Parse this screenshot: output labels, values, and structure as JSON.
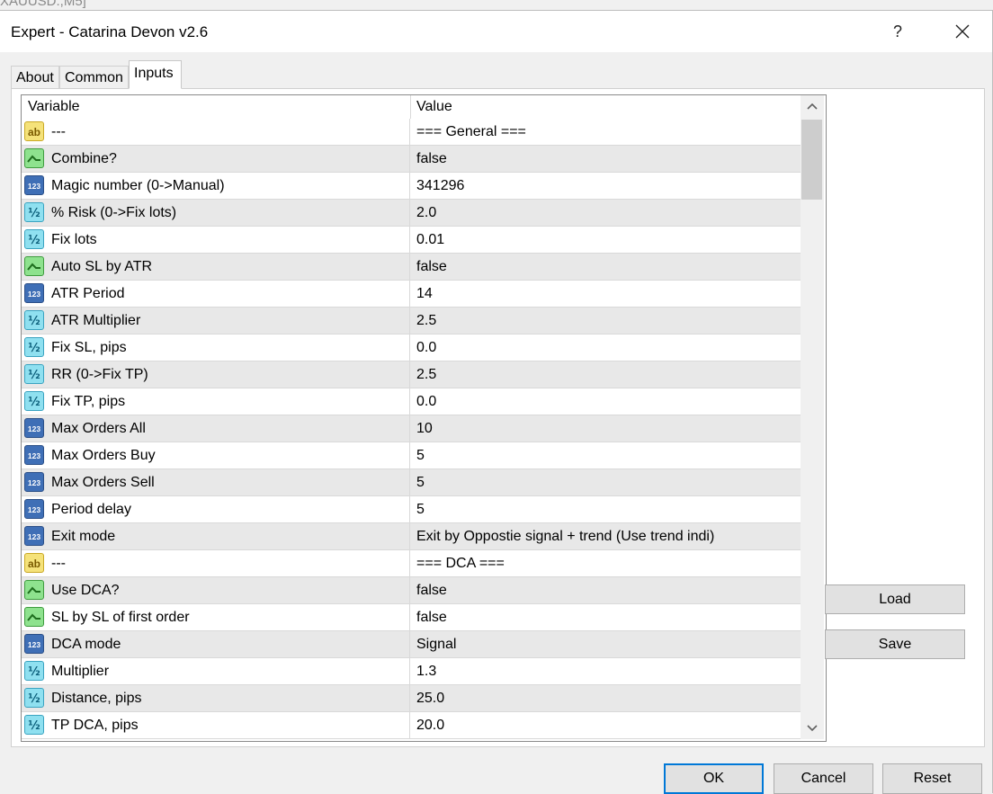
{
  "background": {
    "title_fragment": "XAUUSD.,M5]"
  },
  "window": {
    "title": "Expert - Catarina Devon v2.6",
    "help_label": "?",
    "close_label": "✕"
  },
  "tabs": [
    {
      "label": "About"
    },
    {
      "label": "Common"
    },
    {
      "label": "Inputs",
      "active": true
    }
  ],
  "grid": {
    "columns": {
      "variable": "Variable",
      "value": "Value"
    },
    "rows": [
      {
        "type": "string",
        "variable": "---",
        "value": "=== General ==="
      },
      {
        "type": "bool",
        "variable": "Combine?",
        "value": "false"
      },
      {
        "type": "int",
        "variable": "Magic number (0->Manual)",
        "value": "341296"
      },
      {
        "type": "double",
        "variable": "% Risk (0->Fix lots)",
        "value": "2.0"
      },
      {
        "type": "double",
        "variable": "Fix lots",
        "value": "0.01"
      },
      {
        "type": "bool",
        "variable": "Auto SL by ATR",
        "value": "false"
      },
      {
        "type": "int",
        "variable": "ATR Period",
        "value": "14"
      },
      {
        "type": "double",
        "variable": "ATR Multiplier",
        "value": "2.5"
      },
      {
        "type": "double",
        "variable": "Fix SL, pips",
        "value": "0.0"
      },
      {
        "type": "double",
        "variable": "RR (0->Fix TP)",
        "value": "2.5"
      },
      {
        "type": "double",
        "variable": "Fix TP, pips",
        "value": "0.0"
      },
      {
        "type": "int",
        "variable": "Max Orders All",
        "value": "10"
      },
      {
        "type": "int",
        "variable": "Max Orders Buy",
        "value": "5"
      },
      {
        "type": "int",
        "variable": "Max Orders Sell",
        "value": "5"
      },
      {
        "type": "int",
        "variable": "Period delay",
        "value": "5"
      },
      {
        "type": "int",
        "variable": "Exit mode",
        "value": "Exit by Oppostie signal + trend (Use trend indi)"
      },
      {
        "type": "string",
        "variable": "---",
        "value": "=== DCA ==="
      },
      {
        "type": "bool",
        "variable": "Use DCA?",
        "value": "false"
      },
      {
        "type": "bool",
        "variable": "SL by SL of first order",
        "value": "false"
      },
      {
        "type": "int",
        "variable": "DCA mode",
        "value": "Signal"
      },
      {
        "type": "double",
        "variable": "Multiplier",
        "value": "1.3"
      },
      {
        "type": "double",
        "variable": "Distance, pips",
        "value": "25.0"
      },
      {
        "type": "double",
        "variable": "TP DCA, pips",
        "value": "20.0"
      }
    ]
  },
  "icons": {
    "string": {
      "name": "string-type-icon",
      "text": "ab",
      "bg": "#f5e27a",
      "border": "#c9a825",
      "fg": "#7a5a00"
    },
    "bool": {
      "name": "bool-type-icon",
      "bg": "#8ee28e",
      "border": "#3f9b3f",
      "fg": "#1e6e1e"
    },
    "int": {
      "name": "integer-type-icon",
      "text": "123",
      "bg": "#3f6fb6",
      "border": "#2b4f87",
      "fg": "#ffffff"
    },
    "double": {
      "name": "double-type-icon",
      "text": "½",
      "bg": "#8fe0f0",
      "border": "#3aa3c0",
      "fg": "#0b5e7a"
    }
  },
  "buttons": {
    "load": "Load",
    "save": "Save",
    "ok": "OK",
    "cancel": "Cancel",
    "reset": "Reset"
  }
}
